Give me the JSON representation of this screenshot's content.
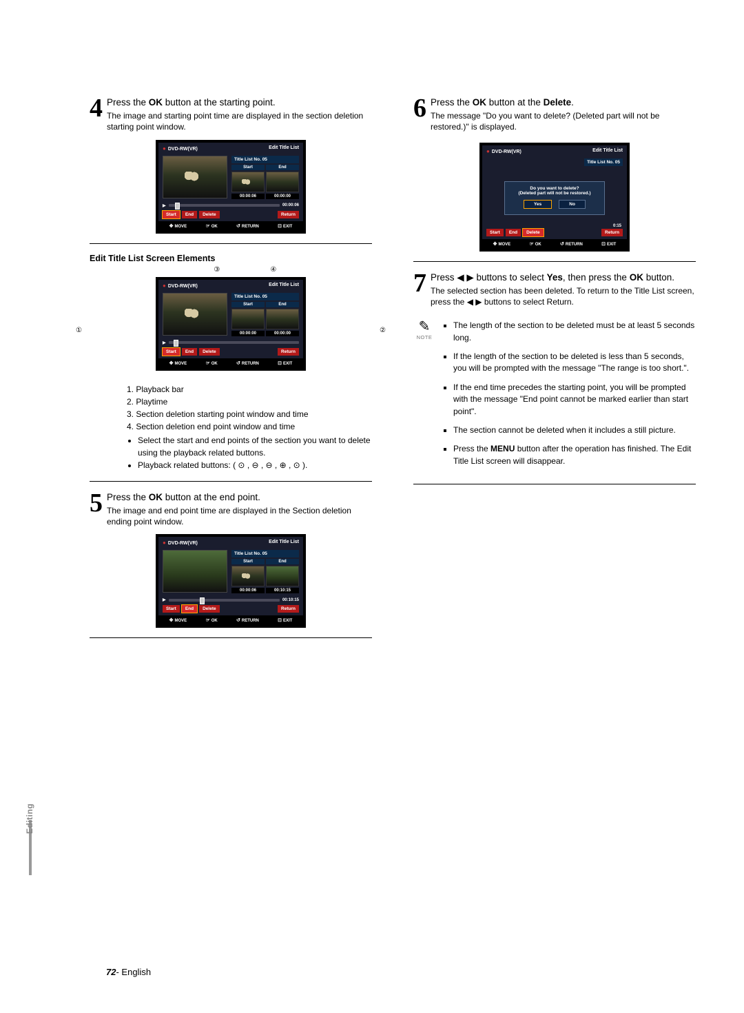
{
  "left": {
    "step4": {
      "num": "4",
      "lead_a": "Press the ",
      "lead_b": "OK",
      "lead_c": " button at the starting point.",
      "sub": "The image and starting point time are displayed in the section deletion starting point window."
    },
    "ui4": {
      "disc": "DVD-RW(VR)",
      "title": "Edit Title List",
      "titleNo": "Title List No. 05",
      "hdrStart": "Start",
      "hdrEnd": "End",
      "t1": "00:00:06",
      "t2": "00:00:00",
      "total": "00:00:06",
      "bStart": "Start",
      "bEnd": "End",
      "bDelete": "Delete",
      "bReturn": "Return",
      "fMove": "MOVE",
      "fOk": "OK",
      "fReturn": "RETURN",
      "fExit": "EXIT",
      "marker_pct": "6"
    },
    "elements_title": "Edit Title List Screen Elements",
    "callouts": {
      "c1": "①",
      "c2": "②",
      "c3": "③",
      "c4": "④"
    },
    "uiE": {
      "disc": "DVD-RW(VR)",
      "title": "Edit Title List",
      "titleNo": "Title List No. 05",
      "hdrStart": "Start",
      "hdrEnd": "End",
      "t1": "00:00:00",
      "t2": "00:00:00",
      "bStart": "Start",
      "bEnd": "End",
      "bDelete": "Delete",
      "bReturn": "Return",
      "fMove": "MOVE",
      "fOk": "OK",
      "fReturn": "RETURN",
      "fExit": "EXIT",
      "marker_pct": "4"
    },
    "list": {
      "i1": "1. Playback bar",
      "i2": "2. Playtime",
      "i3": "3. Section deletion starting point window and time",
      "i4": "4. Section deletion end point window and time",
      "s1": "Select the start and end points of the section you want to delete using the playback related buttons.",
      "s2": "Playback related buttons: "
    },
    "step5": {
      "num": "5",
      "lead_a": "Press the ",
      "lead_b": "OK",
      "lead_c": " button at the end point.",
      "sub": "The image and end point time are displayed in the Section deletion ending point window."
    },
    "ui5": {
      "disc": "DVD-RW(VR)",
      "title": "Edit Title List",
      "titleNo": "Title List No. 05",
      "hdrStart": "Start",
      "hdrEnd": "End",
      "t1": "00:00:06",
      "t2": "00:10:15",
      "total": "00:10:15",
      "bStart": "Start",
      "bEnd": "End",
      "bDelete": "Delete",
      "bReturn": "Return",
      "fMove": "MOVE",
      "fOk": "OK",
      "fReturn": "RETURN",
      "fExit": "EXIT",
      "marker_pct": "28"
    }
  },
  "right": {
    "step6": {
      "num": "6",
      "lead_a": "Press the ",
      "lead_b": "OK",
      "lead_c": " button at the ",
      "lead_d": "Delete",
      "lead_e": ".",
      "sub": "The message \"Do you want to delete? (Deleted part will not be restored.)\" is displayed."
    },
    "ui6": {
      "disc": "DVD-RW(VR)",
      "title": "Edit Title List",
      "titleNo": "Title List No. 05",
      "total": "0:15",
      "dlg1": "Do you want to delete?",
      "dlg2": "(Deleted part will not be restored.)",
      "yes": "Yes",
      "no": "No",
      "bStart": "Start",
      "bEnd": "End",
      "bDelete": "Delete",
      "bReturn": "Return",
      "fMove": "MOVE",
      "fOk": "OK",
      "fReturn": "RETURN",
      "fExit": "EXIT",
      "marker_pct": "28"
    },
    "step7": {
      "num": "7",
      "lead_a": "Press ◀ ▶ buttons to select ",
      "lead_b": "Yes",
      "lead_c": ", then press the ",
      "lead_d": "OK",
      "lead_e": " button.",
      "sub": "The selected section has been deleted. To return to the Title List screen, press the ◀ ▶ buttons to select Return."
    },
    "note_label": "NOTE",
    "notes": {
      "n1": "The length of the section to be deleted must be at least 5 seconds long.",
      "n2": "If the length of the section to be deleted is less than 5 seconds, you will be prompted with the message \"The range is too short.\".",
      "n3": "If the end time precedes the starting point, you will be prompted with the message \"End point cannot be marked earlier than start point\".",
      "n4": "The section cannot be deleted when it includes a still picture.",
      "n5_a": "Press the ",
      "n5_b": "MENU",
      "n5_c": " button after the operation has finished. The Edit Title List screen will disappear."
    }
  },
  "tab": "Editing",
  "footer": {
    "num": "72",
    "sep": "- ",
    "lang": "English"
  }
}
